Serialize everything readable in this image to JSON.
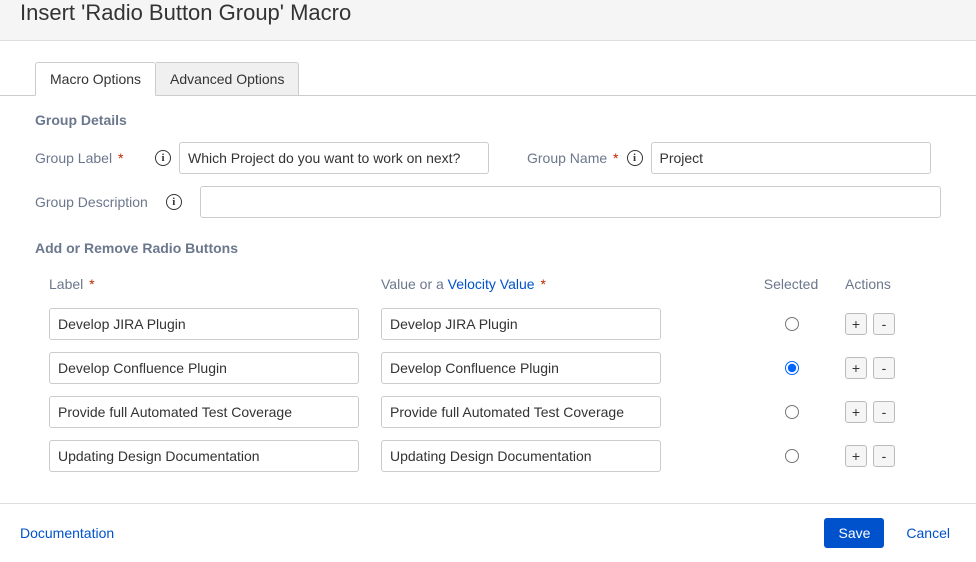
{
  "dialog": {
    "title": "Insert 'Radio Button Group' Macro"
  },
  "tabs": {
    "macro_options": "Macro Options",
    "advanced_options": "Advanced Options"
  },
  "group_details": {
    "heading": "Group Details",
    "label_field": {
      "label": "Group Label",
      "value": "Which Project do you want to work on next?"
    },
    "name_field": {
      "label": "Group Name",
      "value": "Project"
    },
    "desc_field": {
      "label": "Group Description",
      "value": ""
    }
  },
  "radio_section": {
    "heading": "Add or Remove Radio Buttons",
    "headers": {
      "label": "Label",
      "value_prefix": "Value or a ",
      "value_link": "Velocity Value",
      "selected": "Selected",
      "actions": "Actions"
    },
    "rows": [
      {
        "label": "Develop JIRA Plugin",
        "value": "Develop JIRA Plugin",
        "selected": false
      },
      {
        "label": "Develop Confluence Plugin",
        "value": "Develop Confluence Plugin",
        "selected": true
      },
      {
        "label": "Provide full Automated Test Coverage",
        "value": "Provide full Automated Test Coverage",
        "selected": false
      },
      {
        "label": "Updating Design Documentation",
        "value": "Updating Design Documentation",
        "selected": false
      }
    ]
  },
  "buttons": {
    "add": "+",
    "remove": "-"
  },
  "footer": {
    "documentation": "Documentation",
    "save": "Save",
    "cancel": "Cancel"
  }
}
